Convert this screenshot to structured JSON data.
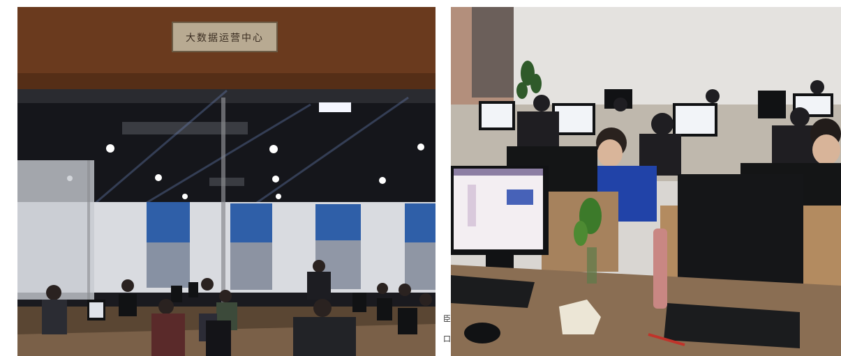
{
  "photos": [
    {
      "scene": "left",
      "sign_text": "大数据运营中心"
    },
    {
      "scene": "right"
    }
  ],
  "edge_fragments": [
    "臣",
    "口"
  ],
  "colors": {
    "ceiling_wood": "#6a3a1e",
    "dark_ceiling": "#15161b",
    "blinds_blue": "#2f5fa8",
    "office_wall": "#e4e2df",
    "desk_wood": "#8a6e53",
    "monitor_black": "#111214"
  }
}
